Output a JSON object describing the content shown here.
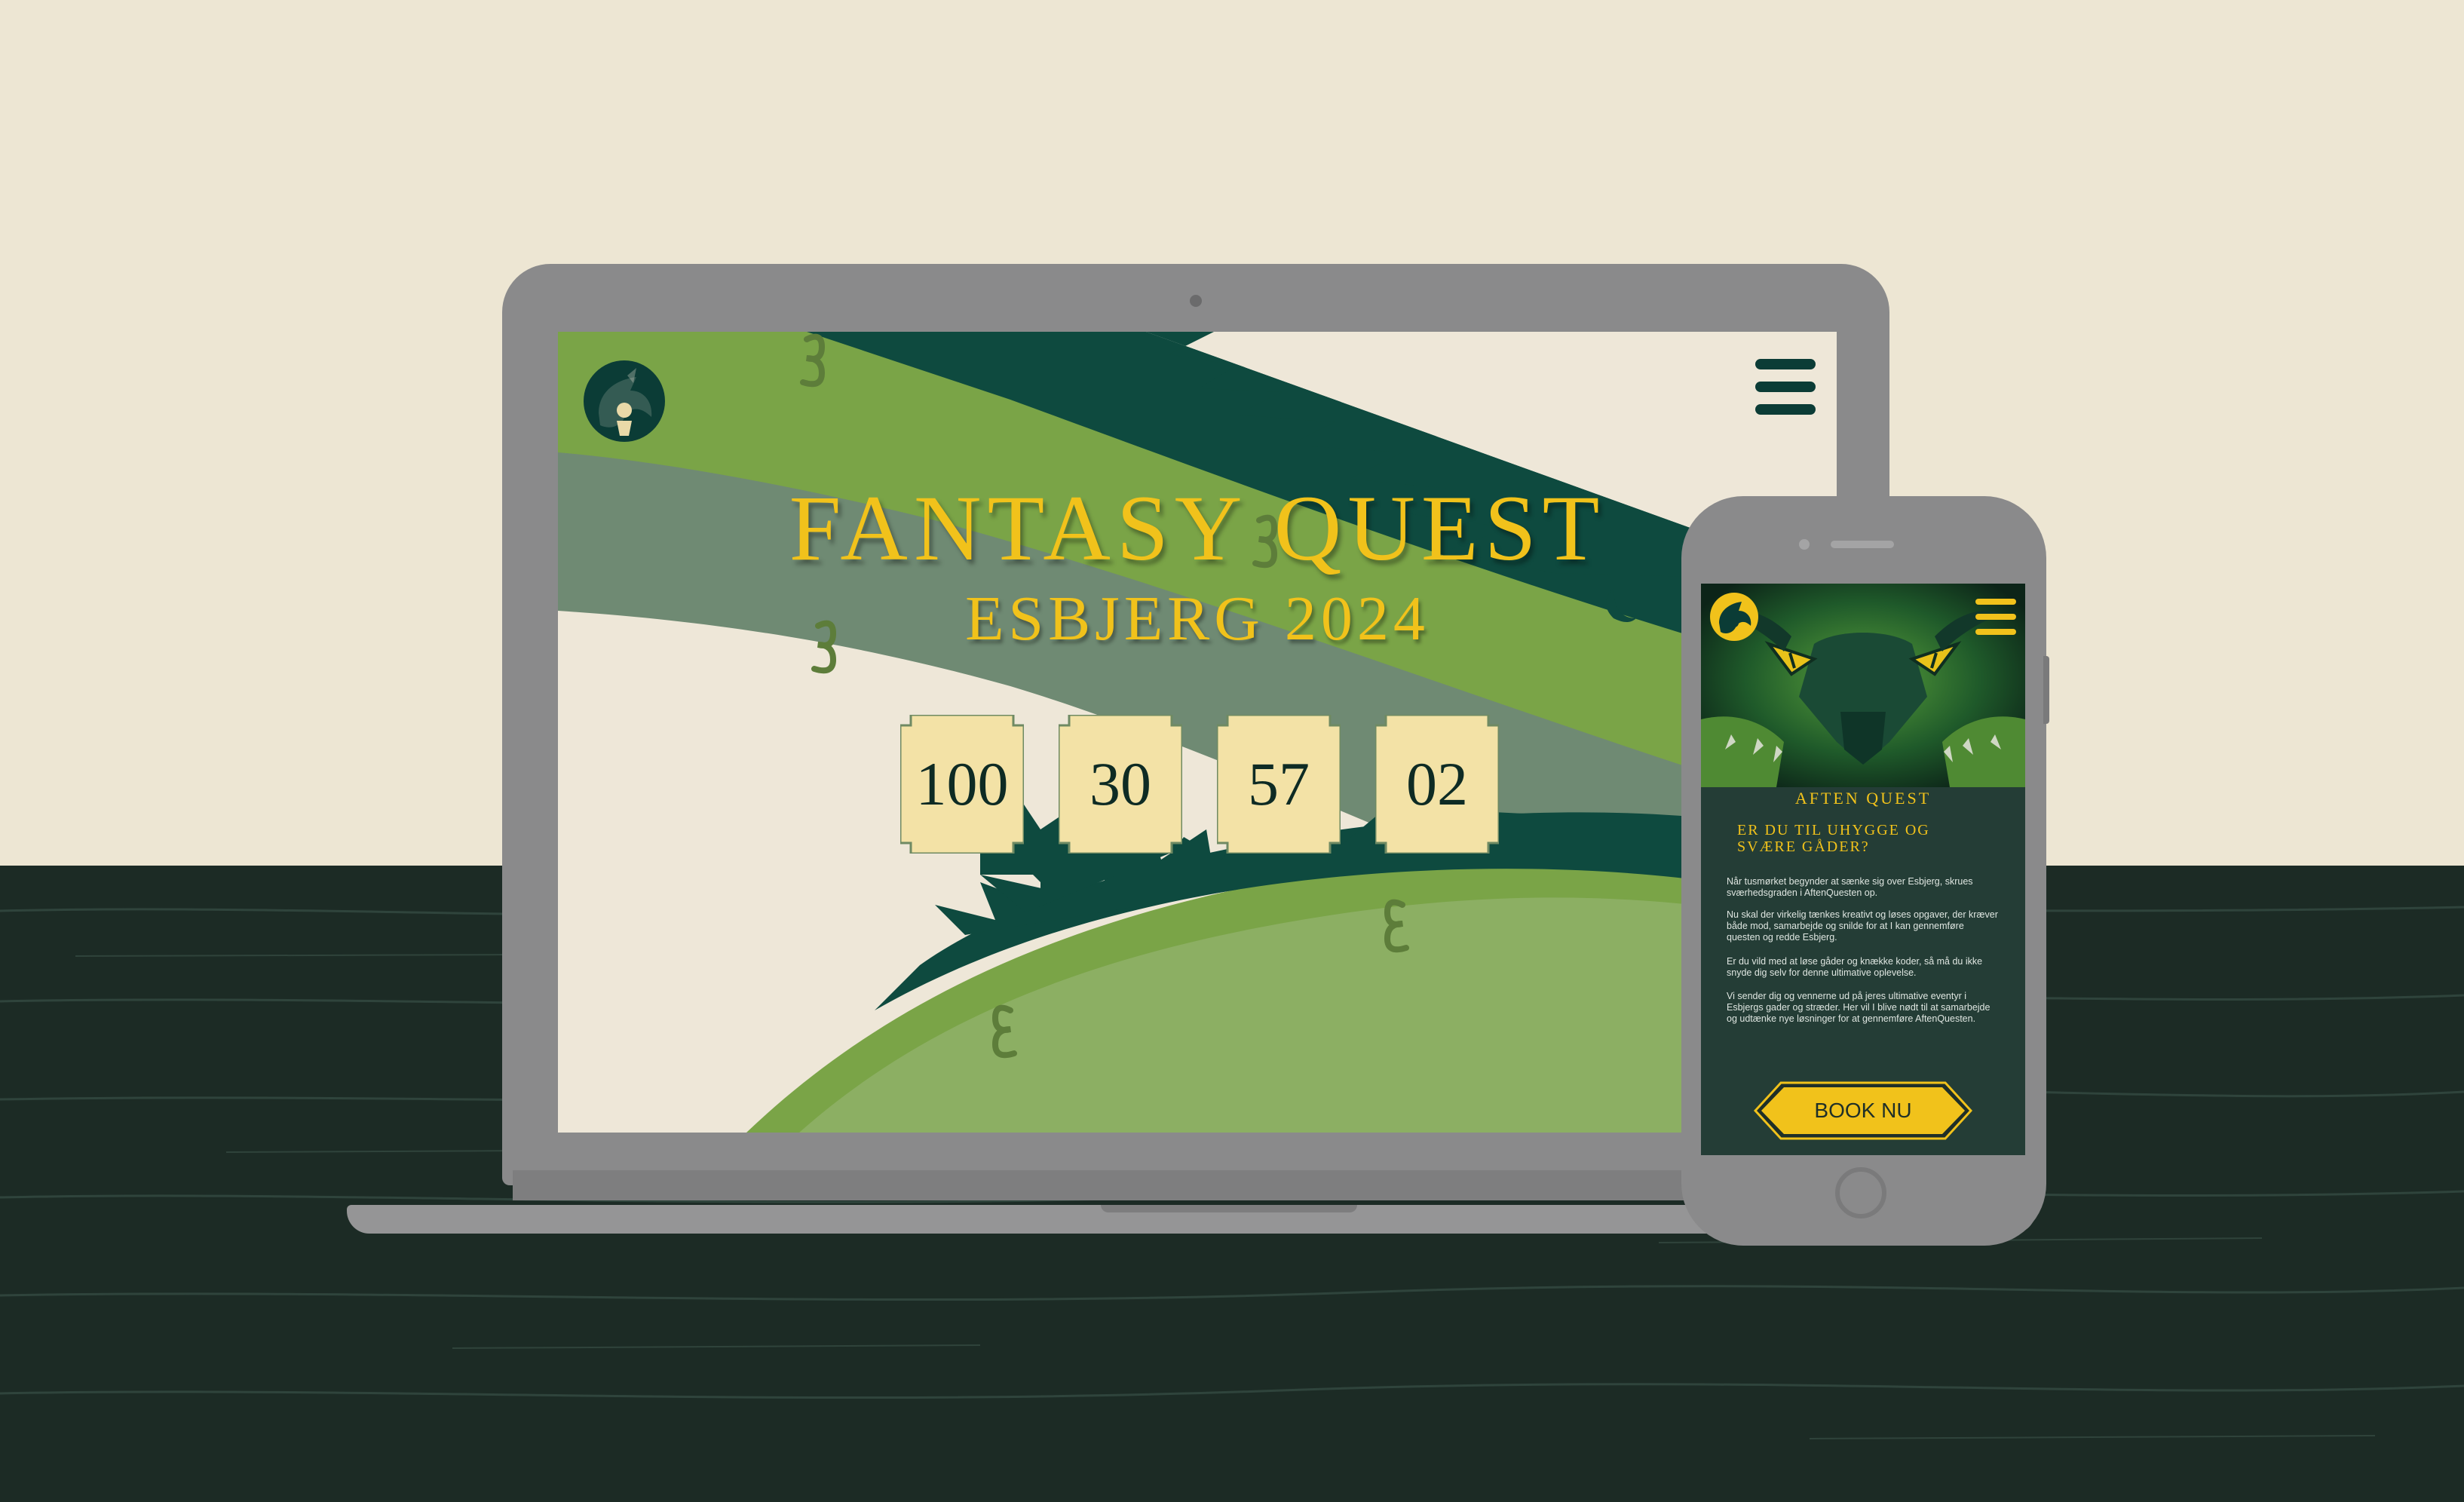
{
  "laptop_site": {
    "title": "FANTASY QUEST",
    "subtitle": "ESBJERG 2024",
    "countdown": [
      "100",
      "30",
      "57",
      "02"
    ]
  },
  "phone_site": {
    "heading": "AFTEN QUEST",
    "lead": "ER DU TIL UHYGGE OG SVÆRE GÅDER?",
    "paragraphs": [
      "Når tusmørket begynder at sænke sig over Esbjerg, skrues sværhedsgraden i AftenQuesten op.",
      "Nu skal der virkelig tænkes kreativt og løses opgaver, der kræver både mod, samarbejde og snilde for at I kan gennemføre questen og redde Esbjerg.",
      "Er du vild med at løse gåder og knække koder, så må du ikke snyde dig selv for denne ultimative oplevelse.",
      "Vi sender dig og vennerne ud på jeres ultimative eventyr i Esbjergs gader og stræder. Her vil I blive nødt til at samarbejde og udtænke nye løsninger for at gennemføre AftenQuesten."
    ],
    "book_button": "BOOK NU"
  },
  "colors": {
    "accent_gold": "#f1c21b",
    "dark_green": "#0b3c36",
    "leaf_green": "#7aa447",
    "cream": "#eee7d8",
    "desk": "#1c2b25"
  }
}
